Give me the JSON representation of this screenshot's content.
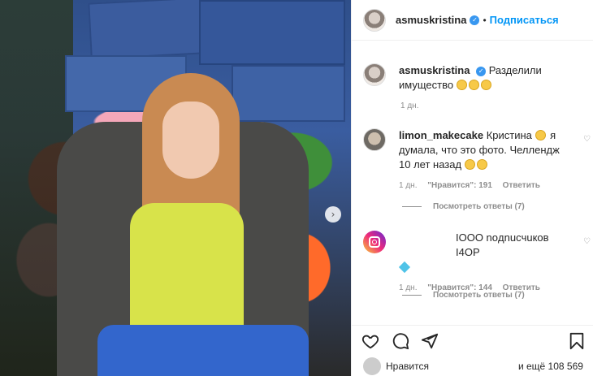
{
  "post": {
    "author": "asmuskristina",
    "follow_label": "Подписаться",
    "separator": "•",
    "caption_text": "Разделили имущество",
    "caption_time": "1 дн."
  },
  "comments": [
    {
      "username": "limon_makecake",
      "text_before": "Кристина",
      "text_after": "я думала, что это фото. Челлендж 10 лет назад",
      "time": "1 дн.",
      "likes": "\"Нравится\": 191",
      "reply": "Ответить",
      "view_replies": "Посмотреть ответы (7)"
    },
    {
      "username": "",
      "text": "IOOO noдnucчuков I4OP",
      "time": "1 дн.",
      "likes": "\"Нравится\": 144",
      "reply": "Ответить",
      "view_replies": "Посмотреть ответы (7)"
    }
  ],
  "footer": {
    "likes_prefix": "Нравится",
    "likes_suffix": "и ещё 108 569"
  },
  "icons": {
    "verified": "verified-badge-icon",
    "next": "chevron-right-icon",
    "heart": "heart-icon",
    "comment": "comment-icon",
    "share": "share-icon",
    "save": "bookmark-icon"
  },
  "colors": {
    "accent": "#0095f6",
    "verified": "#3897f0",
    "muted": "#8e8e8e"
  }
}
